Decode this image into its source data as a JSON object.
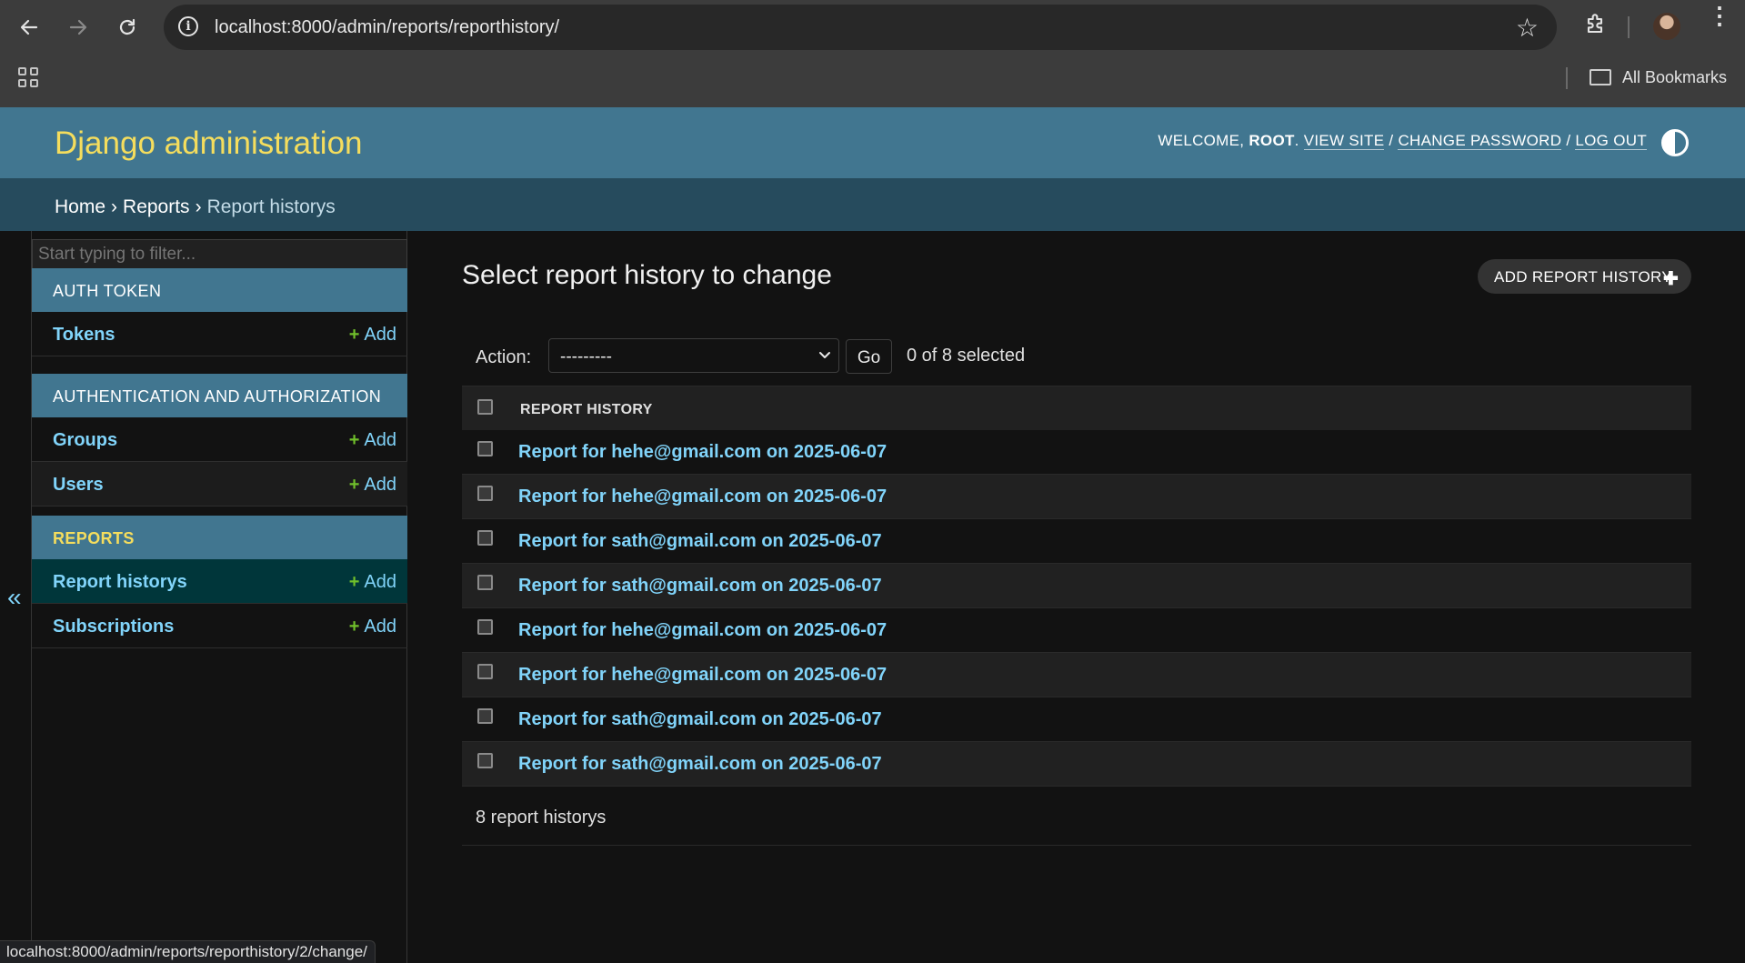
{
  "browser": {
    "url": "localhost:8000/admin/reports/reporthistory/",
    "bookmarks_label": "All Bookmarks",
    "status_url": "localhost:8000/admin/reports/reporthistory/2/change/"
  },
  "header": {
    "brand": "Django administration",
    "welcome": "WELCOME,",
    "username": "ROOT",
    "view_site": "VIEW SITE",
    "change_password": "CHANGE PASSWORD",
    "log_out": "LOG OUT"
  },
  "breadcrumbs": {
    "home": "Home",
    "app": "Reports",
    "current": "Report historys"
  },
  "sidebar": {
    "filter_placeholder": "Start typing to filter...",
    "add_label": "Add",
    "modules": [
      {
        "caption": "AUTH TOKEN",
        "items": [
          {
            "label": "Tokens"
          }
        ]
      },
      {
        "caption": "AUTHENTICATION AND AUTHORIZATION",
        "items": [
          {
            "label": "Groups"
          },
          {
            "label": "Users"
          }
        ]
      },
      {
        "caption": "REPORTS",
        "items": [
          {
            "label": "Report historys"
          },
          {
            "label": "Subscriptions"
          }
        ]
      }
    ],
    "collapse_glyph": "«"
  },
  "main": {
    "title": "Select report history to change",
    "add_button": "ADD REPORT HISTORY",
    "action_label": "Action:",
    "action_selected": "---------",
    "go_label": "Go",
    "counter": "0 of 8 selected",
    "column_header": "REPORT HISTORY",
    "rows": [
      "Report for hehe@gmail.com on 2025-06-07",
      "Report for hehe@gmail.com on 2025-06-07",
      "Report for sath@gmail.com on 2025-06-07",
      "Report for sath@gmail.com on 2025-06-07",
      "Report for hehe@gmail.com on 2025-06-07",
      "Report for hehe@gmail.com on 2025-06-07",
      "Report for sath@gmail.com on 2025-06-07",
      "Report for sath@gmail.com on 2025-06-07"
    ],
    "paginator": "8 report historys"
  },
  "colors": {
    "header_bg": "#417690",
    "brand": "#f5dd5d",
    "breadcrumb_bg": "#264b5d",
    "link": "#81d4fa",
    "add_plus": "#70bf2b",
    "current_row": "#00363a"
  }
}
